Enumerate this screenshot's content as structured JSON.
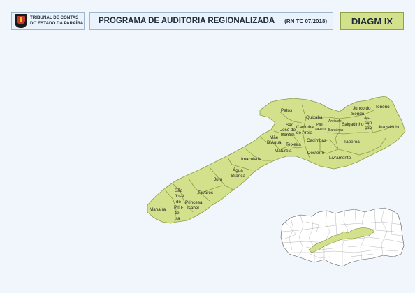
{
  "header": {
    "org_line1": "TRIBUNAL DE CONTAS",
    "org_line2": "DO ESTADO DA PARAÍBA",
    "title": "PROGRAMA DE AUDITORIA REGIONALIZADA",
    "subtitle": "(RN TC 07/2018)",
    "badge": "DIAGM IX"
  },
  "colors": {
    "region_fill": "#d4e18c",
    "region_stroke": "#8a9a44",
    "background": "#f1f6fc"
  },
  "map": {
    "municipalities": {
      "patos": "Patos",
      "quixaba": "Quixaba",
      "passagem_1": "Pas-",
      "passagem_2": "sagem",
      "areia_1": "Areia de",
      "areia_2": "Baraúnas",
      "salgadinho": "Salgadinho",
      "junco_1": "Junco do",
      "junco_2": "Seridó",
      "tenorio": "Tenório",
      "assuncao_1": "As-",
      "assuncao_2": "sun-",
      "assuncao_3": "ção",
      "juazeirinho": "Juazeirinho",
      "sao_jose_1": "São",
      "sao_jose_2": "José do",
      "sao_jose_3": "Bonfim",
      "cacimba_1": "Cacimba",
      "cacimba_2": "de Areia",
      "cacimbas": "Cacimbas",
      "mae_1": "Mãe",
      "mae_2": "D'Água",
      "teixeira": "Teixeira",
      "maturea": "Maturéia",
      "desterro": "Desterro",
      "taperoa": "Taperoá",
      "livramento": "Livramento",
      "imaculada": "Imaculada",
      "agua_1": "Água",
      "agua_2": "Branca",
      "juru": "Juru",
      "tavares": "Tavares",
      "sao_jose_princesa_1": "São",
      "sao_jose_princesa_2": "José",
      "sao_jose_princesa_3": "de",
      "sao_jose_princesa_4": "Prin-",
      "sao_jose_princesa_5": "ce-",
      "sao_jose_princesa_6": "sa",
      "princesa_1": "Princesa",
      "princesa_2": "Isabel",
      "manaira": "Manaíra"
    }
  }
}
